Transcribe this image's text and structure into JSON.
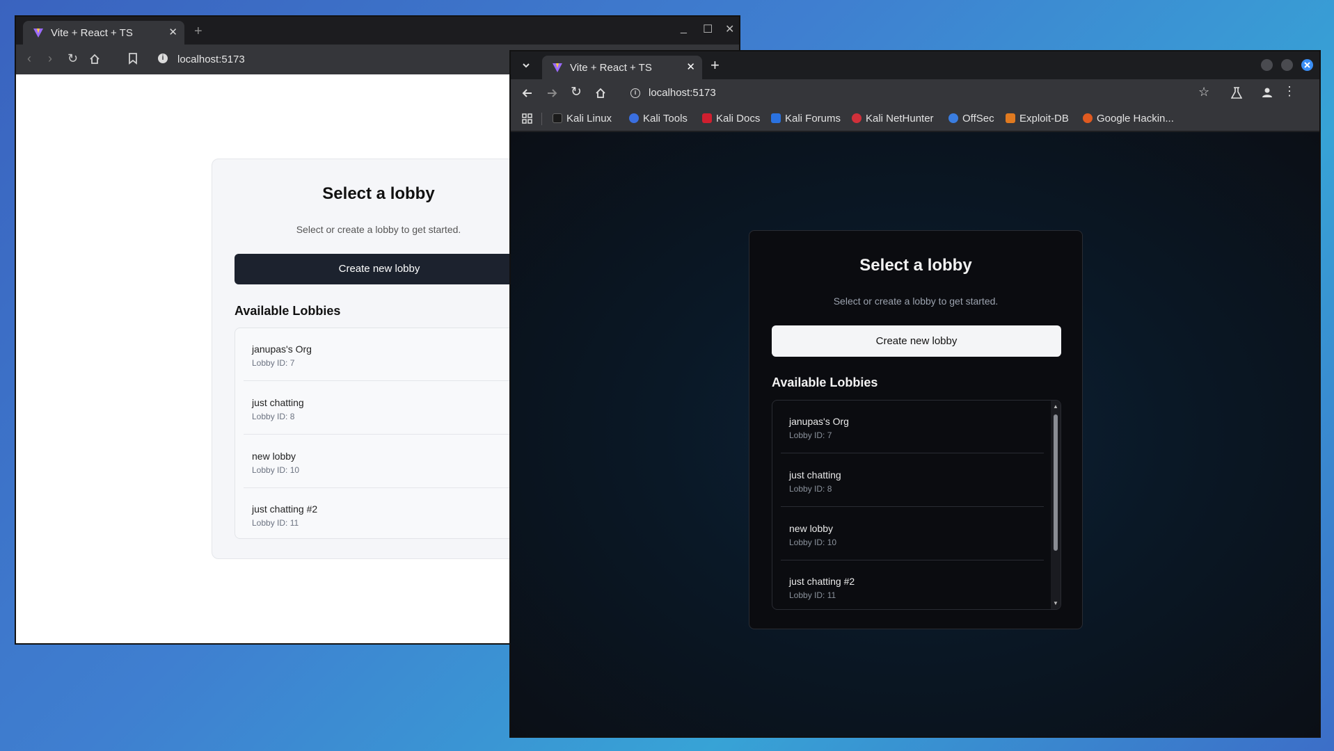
{
  "windows": {
    "back": {
      "tab_title": "Vite + React + TS",
      "tab_close": "✕",
      "new_tab": "+",
      "url": "localhost:5173",
      "controls": {
        "minimize": "_",
        "maximize": "☐",
        "close": "✕"
      }
    },
    "front": {
      "tab_title": "Vite + React + TS",
      "tab_close": "✕",
      "new_tab": "+",
      "url": "localhost:5173",
      "bookmarks": [
        {
          "label": "Kali Linux",
          "color": "#1b1b1b"
        },
        {
          "label": "Kali Tools",
          "color": "#3a6fe0"
        },
        {
          "label": "Kali Docs",
          "color": "#d01f2f"
        },
        {
          "label": "Kali Forums",
          "color": "#2a72e0"
        },
        {
          "label": "Kali NetHunter",
          "color": "#d0303a"
        },
        {
          "label": "OffSec",
          "color": "#3a7de0"
        },
        {
          "label": "Exploit-DB",
          "color": "#e07a20"
        },
        {
          "label": "Google Hackin...",
          "color": "#e05a20"
        }
      ]
    }
  },
  "app": {
    "title": "Select a lobby",
    "subtitle": "Select or create a lobby to get started.",
    "create_button": "Create new lobby",
    "available_heading": "Available Lobbies",
    "lobbies": [
      {
        "name": "janupas's Org",
        "id": "Lobby ID: 7"
      },
      {
        "name": "just chatting",
        "id": "Lobby ID: 8"
      },
      {
        "name": "new lobby",
        "id": "Lobby ID: 10"
      },
      {
        "name": "just chatting #2",
        "id": "Lobby ID: 11"
      }
    ]
  },
  "colors": {
    "light_button_bg": "#1c222e",
    "dark_card_bg": "#0b0c10",
    "close_accent": "#3a8ef5"
  }
}
